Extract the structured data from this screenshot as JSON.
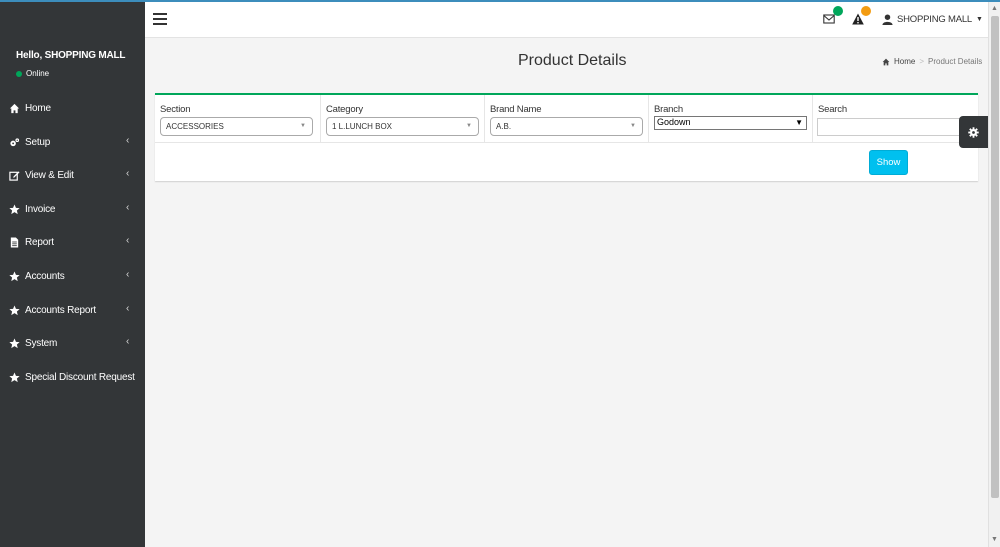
{
  "sidebar": {
    "greeting": "Hello, SHOPPING MALL",
    "status": "Online",
    "items": [
      {
        "label": "Home",
        "icon": "home-icon"
      },
      {
        "label": "Setup",
        "icon": "gears-icon"
      },
      {
        "label": "View & Edit",
        "icon": "edit-icon"
      },
      {
        "label": "Invoice",
        "icon": "star-icon"
      },
      {
        "label": "Report",
        "icon": "file-icon"
      },
      {
        "label": "Accounts",
        "icon": "star-icon"
      },
      {
        "label": "Accounts Report",
        "icon": "star-icon"
      },
      {
        "label": "System",
        "icon": "star-icon"
      },
      {
        "label": "Special Discount Request",
        "icon": "star-icon"
      }
    ]
  },
  "header": {
    "user_name": "SHOPPING MALL"
  },
  "page": {
    "title": "Product Details",
    "breadcrumb_home": "Home",
    "breadcrumb_sep": ">",
    "breadcrumb_current": "Product Details"
  },
  "filters": {
    "section_label": "Section",
    "section_value": "ACCESSORIES",
    "category_label": "Category",
    "category_value": "1 L.LUNCH BOX",
    "brand_label": "Brand Name",
    "brand_value": "A.B.",
    "branch_label": "Branch",
    "branch_value": "Godown",
    "search_label": "Search",
    "search_value": ""
  },
  "actions": {
    "show_label": "Show"
  },
  "colors": {
    "sidebar_bg": "#333638",
    "box_border": "#00a65a",
    "show_button": "#00c0ef",
    "status_online": "#00a65a",
    "badge_green": "#00a65a",
    "badge_orange": "#f39c12"
  }
}
